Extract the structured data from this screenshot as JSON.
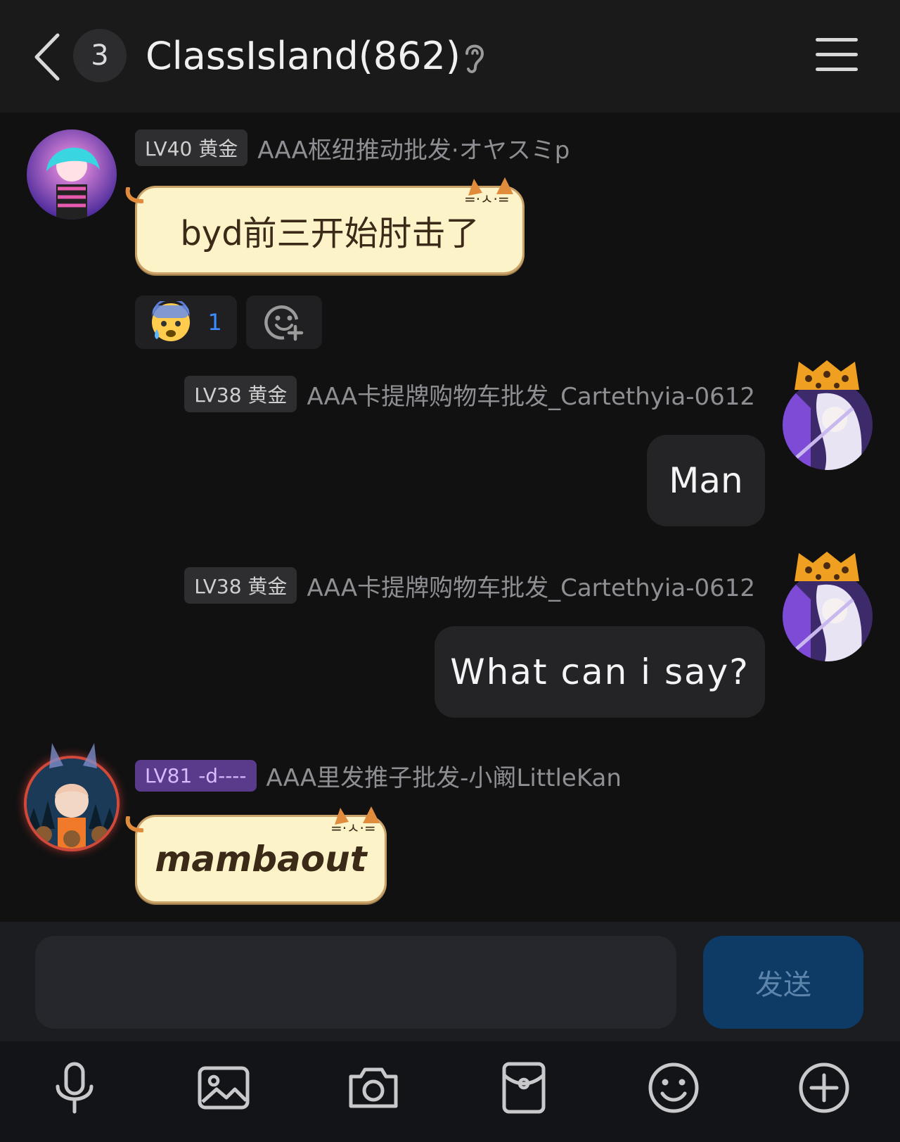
{
  "header": {
    "unread_count": "3",
    "title": "ClassIsland(862)"
  },
  "messages": [
    {
      "level": "LV40 黄金",
      "username": "AAA枢纽推动批发·オヤスミp",
      "text": "byd前三开始肘击了",
      "reaction_count": "1"
    },
    {
      "level": "LV38 黄金",
      "username": "AAA卡提牌购物车批发_Cartethyia-0612",
      "text": "Man"
    },
    {
      "level": "LV38 黄金",
      "username": "AAA卡提牌购物车批发_Cartethyia-0612",
      "text": "What can i say?"
    },
    {
      "level": "LV81 -d----",
      "username": "AAA里发推子批发-小阚LittleKan",
      "text": "mambaout"
    }
  ],
  "composer": {
    "input_value": "",
    "send_label": "发送"
  },
  "toolbar": {
    "icons": [
      "microphone-icon",
      "image-icon",
      "camera-icon",
      "red-packet-icon",
      "emoji-icon",
      "plus-icon"
    ]
  },
  "colors": {
    "send_button": "#0d3b66",
    "cute_bubble": "#fdf3c8",
    "reaction_count": "#3d8cff"
  }
}
